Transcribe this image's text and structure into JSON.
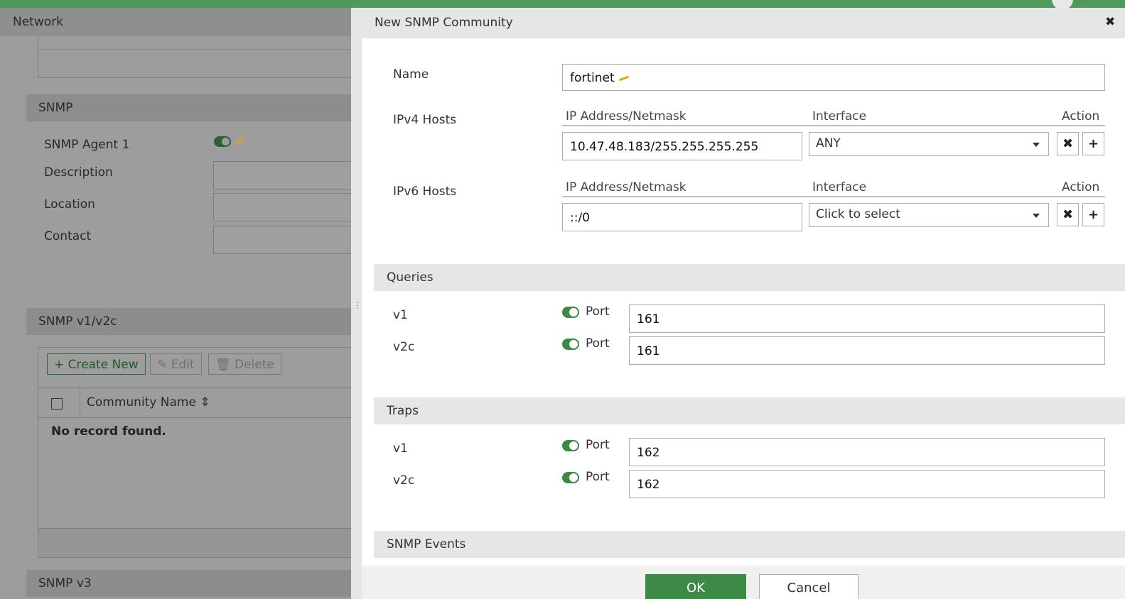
{
  "background": {
    "network_title": "Network",
    "snmp_section": "SNMP",
    "agent_label": "SNMP Agent 1",
    "description_label": "Description",
    "location_label": "Location",
    "contact_label": "Contact",
    "v1v2c_section": "SNMP v1/v2c",
    "buttons": {
      "create": "Create New",
      "edit": "Edit",
      "delete": "Delete"
    },
    "table": {
      "column": "Community Name",
      "empty": "No record found."
    },
    "v3_section": "SNMP v3"
  },
  "dialog": {
    "title": "New SNMP Community",
    "name_label": "Name",
    "name_value": "fortinet",
    "ipv4": {
      "label": "IPv4 Hosts",
      "col_ip": "IP Address/Netmask",
      "col_iface": "Interface",
      "col_action": "Action",
      "ip_value": "10.47.48.183/255.255.255.255",
      "iface_value": "ANY"
    },
    "ipv6": {
      "label": "IPv6 Hosts",
      "col_ip": "IP Address/Netmask",
      "col_iface": "Interface",
      "col_action": "Action",
      "ip_value": "::/0",
      "iface_value": "Click to select"
    },
    "queries": {
      "title": "Queries",
      "v1_label": "v1",
      "v1_port_label": "Port",
      "v1_port": "161",
      "v2c_label": "v2c",
      "v2c_port_label": "Port",
      "v2c_port": "161"
    },
    "traps": {
      "title": "Traps",
      "v1_label": "v1",
      "v1_port_label": "Port",
      "v1_port": "162",
      "v2c_label": "v2c",
      "v2c_port_label": "Port",
      "v2c_port": "162"
    },
    "events_title": "SNMP Events",
    "ok_label": "OK",
    "cancel_label": "Cancel"
  }
}
